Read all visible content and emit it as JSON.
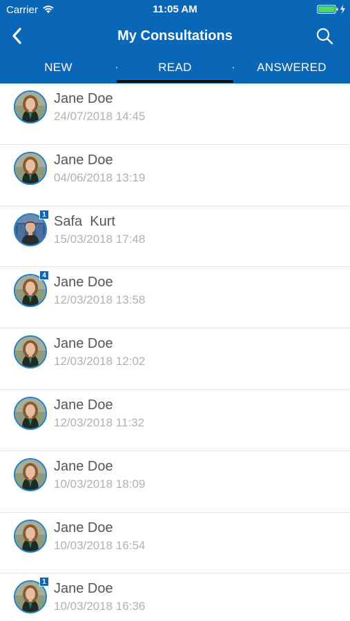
{
  "status_bar": {
    "carrier": "Carrier",
    "time": "11:05 AM"
  },
  "nav": {
    "title": "My Consultations",
    "back_icon": "chevron-left-icon",
    "search_icon": "search-icon"
  },
  "tabs": [
    {
      "label": "NEW"
    },
    {
      "label": "READ",
      "selected": true
    },
    {
      "label": "ANSWERED"
    }
  ],
  "colors": {
    "header": "#0a67b8",
    "tab_indicator": "#111111",
    "name": "#555555",
    "date": "#b1b1b1",
    "badge": "#0a67b8"
  },
  "consultations": [
    {
      "name": "Jane Doe",
      "date": "24/07/2018 14:45",
      "badge": "",
      "avatar": "woman-portrait"
    },
    {
      "name": "Jane Doe",
      "date": "04/06/2018 13:19",
      "badge": "",
      "avatar": "woman-portrait"
    },
    {
      "name": "Safa  Kurt",
      "date": "15/03/2018 17:48",
      "badge": "1",
      "avatar": "man-portrait"
    },
    {
      "name": "Jane Doe",
      "date": "12/03/2018 13:58",
      "badge": "4",
      "avatar": "woman-portrait"
    },
    {
      "name": "Jane Doe",
      "date": "12/03/2018 12:02",
      "badge": "",
      "avatar": "woman-portrait"
    },
    {
      "name": "Jane Doe",
      "date": "12/03/2018 11:32",
      "badge": "",
      "avatar": "woman-portrait"
    },
    {
      "name": "Jane Doe",
      "date": "10/03/2018 18:09",
      "badge": "",
      "avatar": "woman-portrait"
    },
    {
      "name": "Jane Doe",
      "date": "10/03/2018 16:54",
      "badge": "",
      "avatar": "woman-portrait"
    },
    {
      "name": "Jane Doe",
      "date": "10/03/2018 16:36",
      "badge": "1",
      "avatar": "woman-portrait"
    }
  ]
}
